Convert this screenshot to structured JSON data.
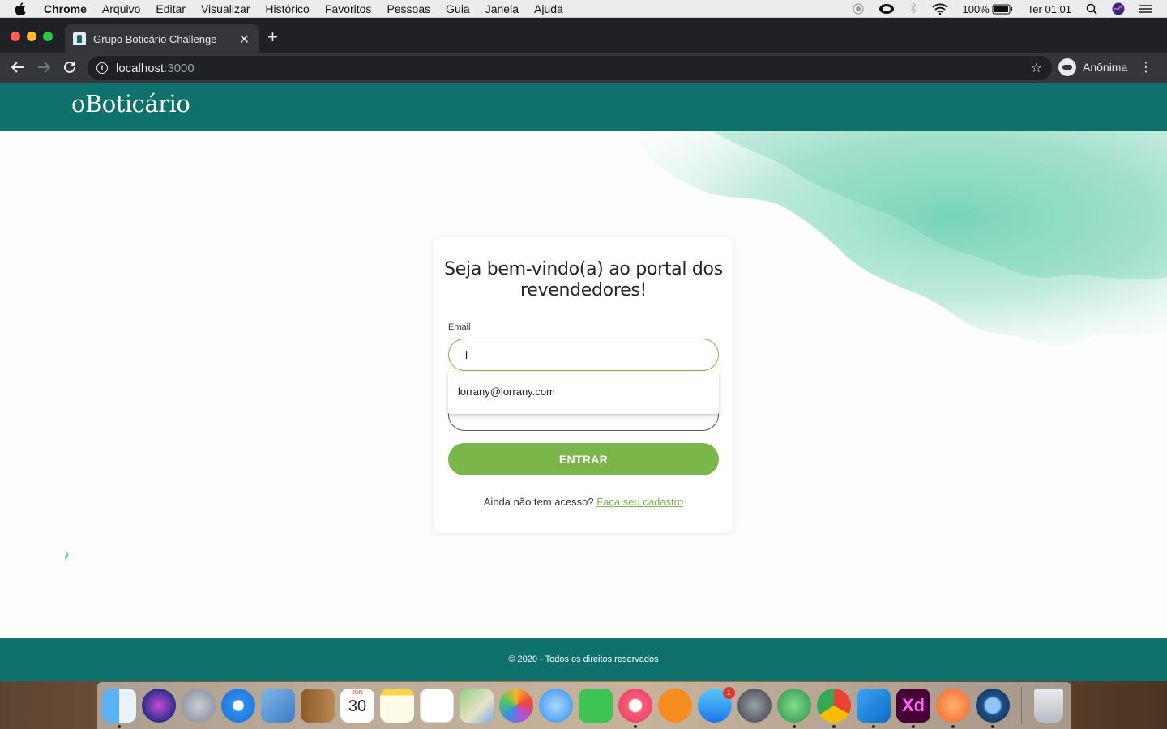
{
  "menubar": {
    "app_name": "Chrome",
    "items": [
      "Arquivo",
      "Editar",
      "Visualizar",
      "Histórico",
      "Favoritos",
      "Pessoas",
      "Guia",
      "Janela",
      "Ajuda"
    ],
    "battery": "100%",
    "clock": "Ter 01:01"
  },
  "browser": {
    "tab_title": "Grupo Boticário Challenge",
    "url_host": "localhost",
    "url_port": ":3000",
    "profile_label": "Anônima"
  },
  "site": {
    "logo": "oBoticário",
    "accent_color": "#0f716b",
    "button_color": "#7ab649",
    "footer_text": "© 2020 - Todos os direitos reservados"
  },
  "login": {
    "heading_line1": "Seja bem-vindo(a) ao portal dos",
    "heading_line2": "revendedores!",
    "email_label": "Email",
    "email_value": "l",
    "autocomplete_option": "lorrany@lorrany.com",
    "password_mask": "••••••••••",
    "submit_label": "ENTRAR",
    "signup_prompt": "Ainda não tem acesso?",
    "signup_link": "Faça seu cadastro"
  },
  "dock": {
    "calendar_month": "JUN",
    "calendar_day": "30",
    "appstore_badge": "1",
    "xd_label": "Xd",
    "apps": [
      "finder-icon",
      "siri-icon",
      "launchpad-icon",
      "safari-icon",
      "mail-icon",
      "contacts-icon",
      "calendar-icon",
      "notes-icon",
      "reminders-icon",
      "maps-icon",
      "photos-icon",
      "messages-icon",
      "facetime-icon",
      "music-icon",
      "books-icon",
      "appstore-icon",
      "system-preferences-icon",
      "android-studio-icon",
      "chrome-icon",
      "vscode-icon",
      "adobe-xd-icon",
      "pencil-app-icon",
      "quicktime-icon",
      "trash-icon"
    ]
  }
}
